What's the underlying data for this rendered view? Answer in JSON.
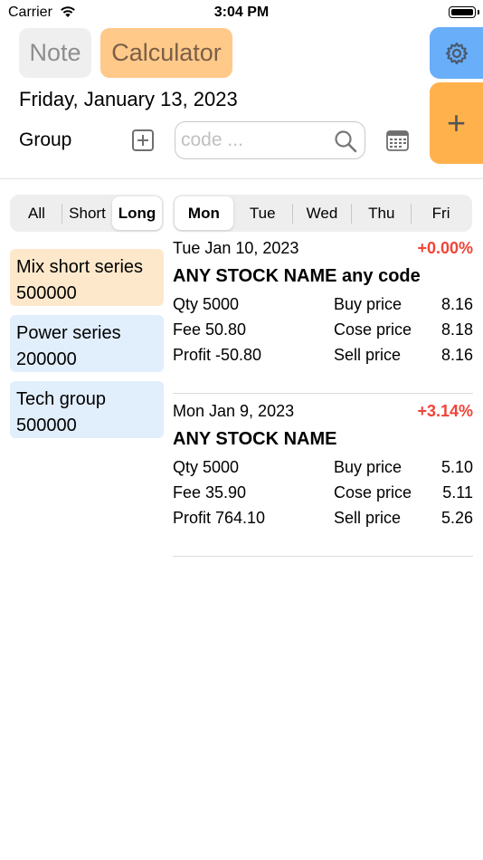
{
  "status_bar": {
    "carrier": "Carrier",
    "time": "3:04 PM"
  },
  "header": {
    "note_label": "Note",
    "calculator_label": "Calculator",
    "add_label": "+",
    "date": "Friday, January 13, 2023",
    "group_label": "Group",
    "search_placeholder": "code ...",
    "search_value": ""
  },
  "icons": {
    "settings": "gear-icon",
    "add": "plus-icon",
    "add_group": "plus-square-icon",
    "search": "magnifier-icon",
    "calendar": "calendar-icon",
    "wifi": "wifi-icon",
    "battery": "battery-icon"
  },
  "colors": {
    "note_bg": "#efefef",
    "calculator_bg": "#ffc98a",
    "settings_bg": "#69aef8",
    "add_bg": "#ffb14c",
    "positive_pct": "#f04438",
    "group_highlight": "#fde8cc",
    "group_default": "#e1eefb"
  },
  "filter_tabs": [
    {
      "label": "All",
      "active": false
    },
    {
      "label": "Short",
      "active": false
    },
    {
      "label": "Long",
      "active": true
    }
  ],
  "day_tabs": [
    {
      "label": "Mon",
      "active": true
    },
    {
      "label": "Tue",
      "active": false
    },
    {
      "label": "Wed",
      "active": false
    },
    {
      "label": "Thu",
      "active": false
    },
    {
      "label": "Fri",
      "active": false
    }
  ],
  "groups": [
    {
      "name": "Mix short series",
      "amount": "500000"
    },
    {
      "name": "Power series",
      "amount": "200000"
    },
    {
      "name": "Tech group",
      "amount": "500000"
    }
  ],
  "records": [
    {
      "date": "Tue Jan 10, 2023",
      "change": "+0.00%",
      "name": "ANY STOCK NAME any code",
      "qty": "Qty 5000",
      "fee": "Fee 50.80",
      "profit": "Profit -50.80",
      "buy_label": "Buy price",
      "buy_value": "8.16",
      "close_label": "Cose price",
      "close_value": "8.18",
      "sell_label": "Sell price",
      "sell_value": "8.16"
    },
    {
      "date": "Mon Jan 9, 2023",
      "change": "+3.14%",
      "name": "ANY STOCK NAME",
      "qty": "Qty 5000",
      "fee": "Fee 35.90",
      "profit": "Profit 764.10",
      "buy_label": "Buy price",
      "buy_value": "5.10",
      "close_label": "Cose price",
      "close_value": "5.11",
      "sell_label": "Sell price",
      "sell_value": "5.26"
    }
  ]
}
